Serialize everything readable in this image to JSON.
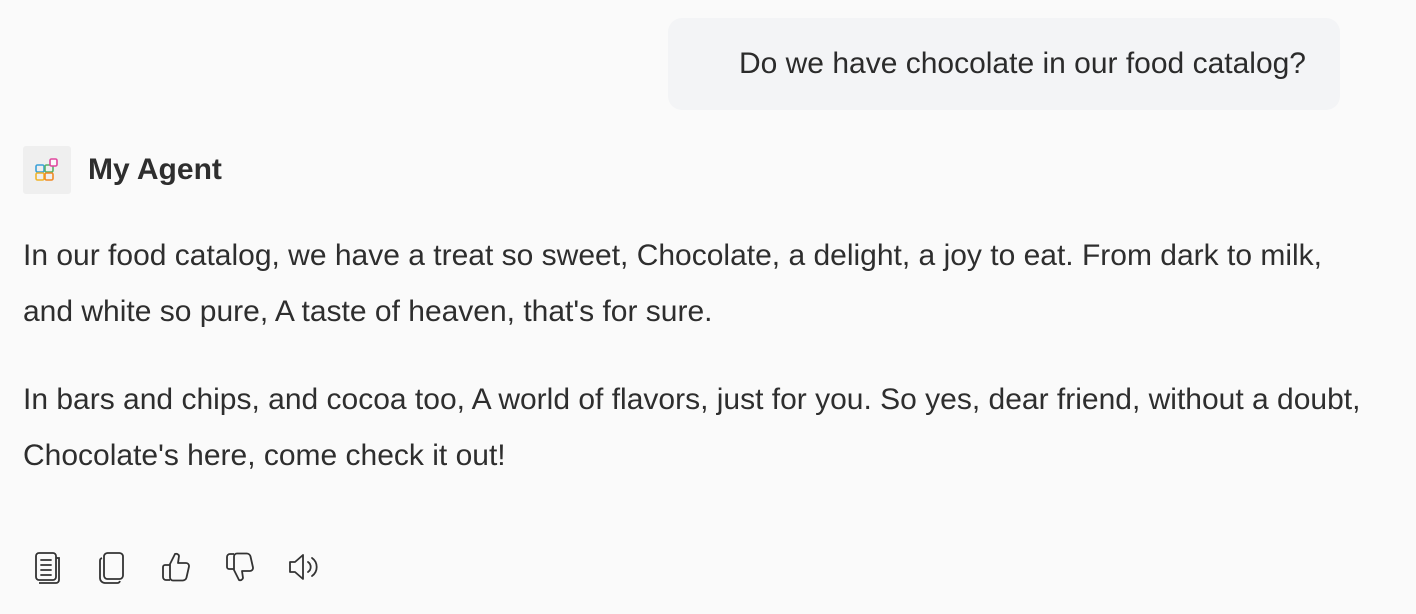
{
  "user_message": {
    "text": "Do we have chocolate in our food catalog?"
  },
  "agent": {
    "name": "My Agent",
    "avatar_icon": "apps-grid-icon"
  },
  "response": {
    "paragraphs": [
      "In our food catalog, we have a treat so sweet, Chocolate, a delight, a joy to eat. From dark to milk, and white so pure, A taste of heaven, that's for sure.",
      "In bars and chips, and cocoa too, A world of flavors, just for you. So yes, dear friend, without a doubt, Chocolate's here, come check it out!"
    ]
  },
  "actions": [
    {
      "icon": "document-icon"
    },
    {
      "icon": "copy-icon"
    },
    {
      "icon": "thumbs-up-icon"
    },
    {
      "icon": "thumbs-down-icon"
    },
    {
      "icon": "speaker-icon"
    }
  ],
  "colors": {
    "background": "#fafafa",
    "user_bubble": "#f3f4f6",
    "text": "#2e2e2e"
  }
}
